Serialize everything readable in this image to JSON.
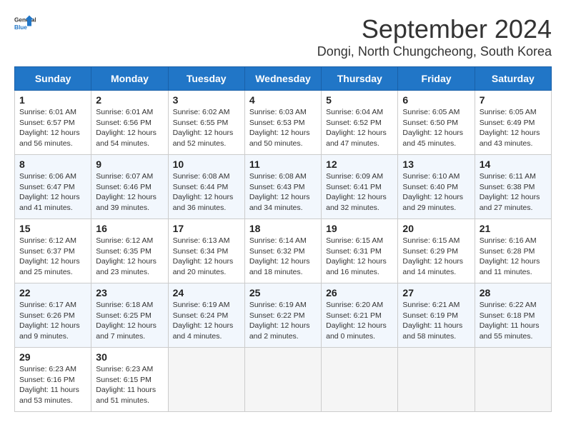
{
  "logo": {
    "line1": "General",
    "line2": "Blue"
  },
  "title": "September 2024",
  "subtitle": "Dongi, North Chungcheong, South Korea",
  "headers": [
    "Sunday",
    "Monday",
    "Tuesday",
    "Wednesday",
    "Thursday",
    "Friday",
    "Saturday"
  ],
  "rows": [
    [
      {
        "day": "1",
        "info": "Sunrise: 6:01 AM\nSunset: 6:57 PM\nDaylight: 12 hours\nand 56 minutes."
      },
      {
        "day": "2",
        "info": "Sunrise: 6:01 AM\nSunset: 6:56 PM\nDaylight: 12 hours\nand 54 minutes."
      },
      {
        "day": "3",
        "info": "Sunrise: 6:02 AM\nSunset: 6:55 PM\nDaylight: 12 hours\nand 52 minutes."
      },
      {
        "day": "4",
        "info": "Sunrise: 6:03 AM\nSunset: 6:53 PM\nDaylight: 12 hours\nand 50 minutes."
      },
      {
        "day": "5",
        "info": "Sunrise: 6:04 AM\nSunset: 6:52 PM\nDaylight: 12 hours\nand 47 minutes."
      },
      {
        "day": "6",
        "info": "Sunrise: 6:05 AM\nSunset: 6:50 PM\nDaylight: 12 hours\nand 45 minutes."
      },
      {
        "day": "7",
        "info": "Sunrise: 6:05 AM\nSunset: 6:49 PM\nDaylight: 12 hours\nand 43 minutes."
      }
    ],
    [
      {
        "day": "8",
        "info": "Sunrise: 6:06 AM\nSunset: 6:47 PM\nDaylight: 12 hours\nand 41 minutes."
      },
      {
        "day": "9",
        "info": "Sunrise: 6:07 AM\nSunset: 6:46 PM\nDaylight: 12 hours\nand 39 minutes."
      },
      {
        "day": "10",
        "info": "Sunrise: 6:08 AM\nSunset: 6:44 PM\nDaylight: 12 hours\nand 36 minutes."
      },
      {
        "day": "11",
        "info": "Sunrise: 6:08 AM\nSunset: 6:43 PM\nDaylight: 12 hours\nand 34 minutes."
      },
      {
        "day": "12",
        "info": "Sunrise: 6:09 AM\nSunset: 6:41 PM\nDaylight: 12 hours\nand 32 minutes."
      },
      {
        "day": "13",
        "info": "Sunrise: 6:10 AM\nSunset: 6:40 PM\nDaylight: 12 hours\nand 29 minutes."
      },
      {
        "day": "14",
        "info": "Sunrise: 6:11 AM\nSunset: 6:38 PM\nDaylight: 12 hours\nand 27 minutes."
      }
    ],
    [
      {
        "day": "15",
        "info": "Sunrise: 6:12 AM\nSunset: 6:37 PM\nDaylight: 12 hours\nand 25 minutes."
      },
      {
        "day": "16",
        "info": "Sunrise: 6:12 AM\nSunset: 6:35 PM\nDaylight: 12 hours\nand 23 minutes."
      },
      {
        "day": "17",
        "info": "Sunrise: 6:13 AM\nSunset: 6:34 PM\nDaylight: 12 hours\nand 20 minutes."
      },
      {
        "day": "18",
        "info": "Sunrise: 6:14 AM\nSunset: 6:32 PM\nDaylight: 12 hours\nand 18 minutes."
      },
      {
        "day": "19",
        "info": "Sunrise: 6:15 AM\nSunset: 6:31 PM\nDaylight: 12 hours\nand 16 minutes."
      },
      {
        "day": "20",
        "info": "Sunrise: 6:15 AM\nSunset: 6:29 PM\nDaylight: 12 hours\nand 14 minutes."
      },
      {
        "day": "21",
        "info": "Sunrise: 6:16 AM\nSunset: 6:28 PM\nDaylight: 12 hours\nand 11 minutes."
      }
    ],
    [
      {
        "day": "22",
        "info": "Sunrise: 6:17 AM\nSunset: 6:26 PM\nDaylight: 12 hours\nand 9 minutes."
      },
      {
        "day": "23",
        "info": "Sunrise: 6:18 AM\nSunset: 6:25 PM\nDaylight: 12 hours\nand 7 minutes."
      },
      {
        "day": "24",
        "info": "Sunrise: 6:19 AM\nSunset: 6:24 PM\nDaylight: 12 hours\nand 4 minutes."
      },
      {
        "day": "25",
        "info": "Sunrise: 6:19 AM\nSunset: 6:22 PM\nDaylight: 12 hours\nand 2 minutes."
      },
      {
        "day": "26",
        "info": "Sunrise: 6:20 AM\nSunset: 6:21 PM\nDaylight: 12 hours\nand 0 minutes."
      },
      {
        "day": "27",
        "info": "Sunrise: 6:21 AM\nSunset: 6:19 PM\nDaylight: 11 hours\nand 58 minutes."
      },
      {
        "day": "28",
        "info": "Sunrise: 6:22 AM\nSunset: 6:18 PM\nDaylight: 11 hours\nand 55 minutes."
      }
    ],
    [
      {
        "day": "29",
        "info": "Sunrise: 6:23 AM\nSunset: 6:16 PM\nDaylight: 11 hours\nand 53 minutes."
      },
      {
        "day": "30",
        "info": "Sunrise: 6:23 AM\nSunset: 6:15 PM\nDaylight: 11 hours\nand 51 minutes."
      },
      {
        "day": "",
        "info": ""
      },
      {
        "day": "",
        "info": ""
      },
      {
        "day": "",
        "info": ""
      },
      {
        "day": "",
        "info": ""
      },
      {
        "day": "",
        "info": ""
      }
    ]
  ]
}
